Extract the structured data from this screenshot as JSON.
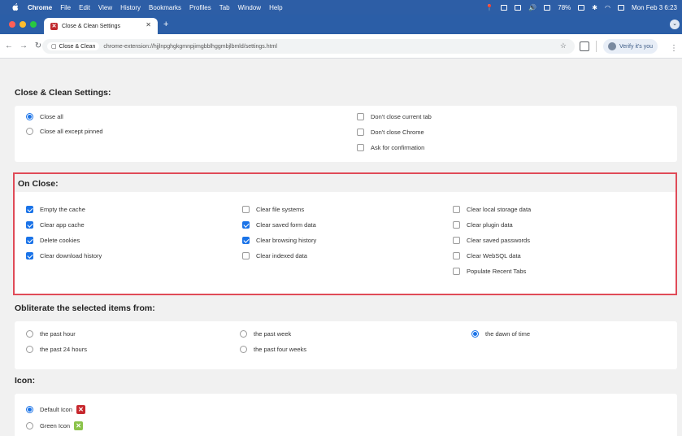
{
  "menubar": {
    "items": [
      "Chrome",
      "File",
      "Edit",
      "View",
      "History",
      "Bookmarks",
      "Profiles",
      "Tab",
      "Window",
      "Help"
    ],
    "battery": "78%",
    "datetime": "Mon Feb 3  6:23"
  },
  "tab": {
    "title": "Close & Clean Settings"
  },
  "toolbar": {
    "chip_label": "Close & Clean",
    "url": "chrome-extension://hjjlnpghgkgmnpjimgbblhggmbjlbmld/settings.html",
    "verify_label": "Verify it's you"
  },
  "settings": {
    "title": "Close & Clean Settings:",
    "close_options": [
      "Close all",
      "Close all except pinned"
    ],
    "close_checkboxes": [
      "Don't close current tab",
      "Don't close Chrome",
      "Ask for confirmation"
    ]
  },
  "on_close": {
    "title": "On Close:",
    "col1": [
      "Empty the cache",
      "Clear app cache",
      "Delete cookies",
      "Clear download history"
    ],
    "col2": [
      "Clear file systems",
      "Clear saved form data",
      "Clear browsing history",
      "Clear indexed data"
    ],
    "col3": [
      "Clear local storage data",
      "Clear plugin data",
      "Clear saved passwords",
      "Clear WebSQL data",
      "Populate Recent Tabs"
    ]
  },
  "obliterate": {
    "title": "Obliterate the selected items from:",
    "options": [
      "the past hour",
      "the past 24 hours",
      "the past week",
      "the past four weeks",
      "the dawn of time"
    ]
  },
  "icon": {
    "title": "Icon:",
    "options": [
      "Default Icon",
      "Green Icon"
    ]
  }
}
